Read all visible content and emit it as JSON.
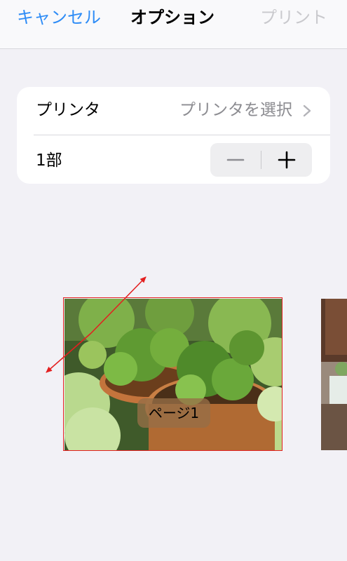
{
  "navbar": {
    "cancel_label": "キャンセル",
    "title": "オプション",
    "print_label": "プリント"
  },
  "options": {
    "printer_label": "プリンタ",
    "printer_value": "プリンタを選択",
    "copies_label": "1部"
  },
  "preview": {
    "page_label": "ページ1"
  },
  "colors": {
    "accent": "#2e8cf6",
    "annotation": "#e32020"
  },
  "icons": {
    "chevron": "chevron-right-icon",
    "minus": "minus-icon",
    "plus": "plus-icon"
  }
}
